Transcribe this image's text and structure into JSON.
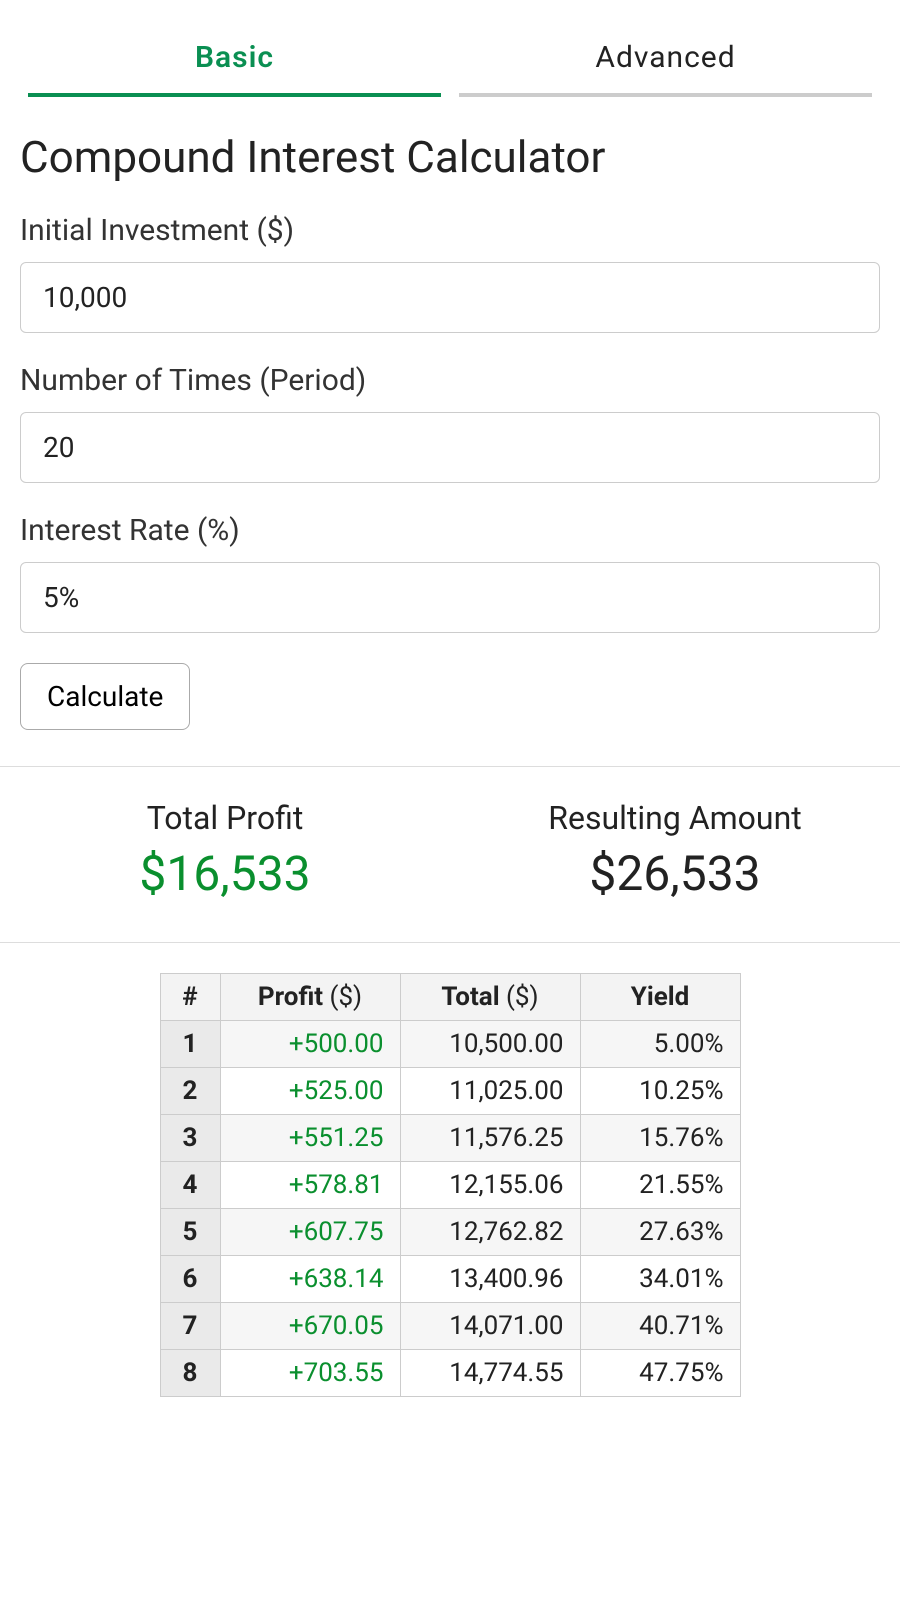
{
  "tabs": {
    "basic": "Basic",
    "advanced": "Advanced"
  },
  "title": "Compound Interest Calculator",
  "fields": {
    "initial": {
      "label": "Initial Investment ($)",
      "value": "10,000"
    },
    "periods": {
      "label": "Number of Times (Period)",
      "value": "20"
    },
    "rate": {
      "label": "Interest Rate (%)",
      "value": "5%"
    }
  },
  "calculate_label": "Calculate",
  "summary": {
    "profit_label": "Total Profit",
    "profit_value": "$16,533",
    "result_label": "Resulting Amount",
    "result_value": "$26,533"
  },
  "table": {
    "headers": {
      "idx": "#",
      "profit_bold": "Profit",
      "profit_thin": " ($)",
      "total_bold": "Total",
      "total_thin": " ($)",
      "yield": "Yield"
    },
    "rows": [
      {
        "n": "1",
        "profit": "+500.00",
        "total": "10,500.00",
        "yield": "5.00%"
      },
      {
        "n": "2",
        "profit": "+525.00",
        "total": "11,025.00",
        "yield": "10.25%"
      },
      {
        "n": "3",
        "profit": "+551.25",
        "total": "11,576.25",
        "yield": "15.76%"
      },
      {
        "n": "4",
        "profit": "+578.81",
        "total": "12,155.06",
        "yield": "21.55%"
      },
      {
        "n": "5",
        "profit": "+607.75",
        "total": "12,762.82",
        "yield": "27.63%"
      },
      {
        "n": "6",
        "profit": "+638.14",
        "total": "13,400.96",
        "yield": "34.01%"
      },
      {
        "n": "7",
        "profit": "+670.05",
        "total": "14,071.00",
        "yield": "40.71%"
      },
      {
        "n": "8",
        "profit": "+703.55",
        "total": "14,774.55",
        "yield": "47.75%"
      }
    ]
  }
}
